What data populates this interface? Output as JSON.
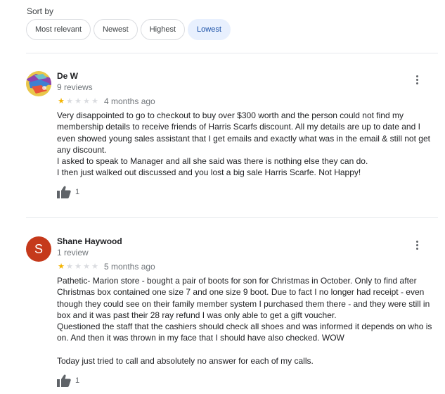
{
  "sort": {
    "label": "Sort by",
    "options": [
      "Most relevant",
      "Newest",
      "Highest",
      "Lowest"
    ],
    "selected": "Lowest"
  },
  "reviews": [
    {
      "name": "De W",
      "count": "9 reviews",
      "rating": 1,
      "age": "4 months ago",
      "body": [
        "Very disappointed to go to checkout to buy over $300 worth and the person could not find my membership details to receive friends of Harris Scarfs discount. All my details are up to date and I even showed young sales assistant that I get emails and exactly what was in the email & still not get any discount.",
        "I asked to speak to Manager and all she said was there is nothing else they can do.",
        "I then just walked out discussed and you lost a big sale Harris Scarfe. Not Happy!"
      ],
      "likes": "1"
    },
    {
      "name": "Shane Haywood",
      "count": "1 review",
      "initial": "S",
      "avatar_color": "#c5391b",
      "rating": 1,
      "age": "5 months ago",
      "body": [
        "Pathetic- Marion store - bought a pair of boots for son for Christmas in October. Only to find after Christmas box contained one size 7 and one size 9 boot. Due to fact I no longer had receipt - even though they could see on their family member system I purchased them there - and they were still in box and it was past their 28 ray refund I was only able to get a gift voucher.",
        "Questioned the staff that the cashiers should check all shoes and was informed it depends on who is on. And then it was thrown in my face that I should have also checked. WOW",
        "",
        "Today just tried to call and absolutely no answer for each of my calls."
      ],
      "likes": "1"
    }
  ],
  "icons": {
    "like": "thumbs-up-icon",
    "more": "more-vert-icon",
    "star": "star-icon"
  },
  "colors": {
    "star_on": "#f4b400",
    "star_off": "#dadce0",
    "selected_chip_bg": "#e8f0fe"
  }
}
